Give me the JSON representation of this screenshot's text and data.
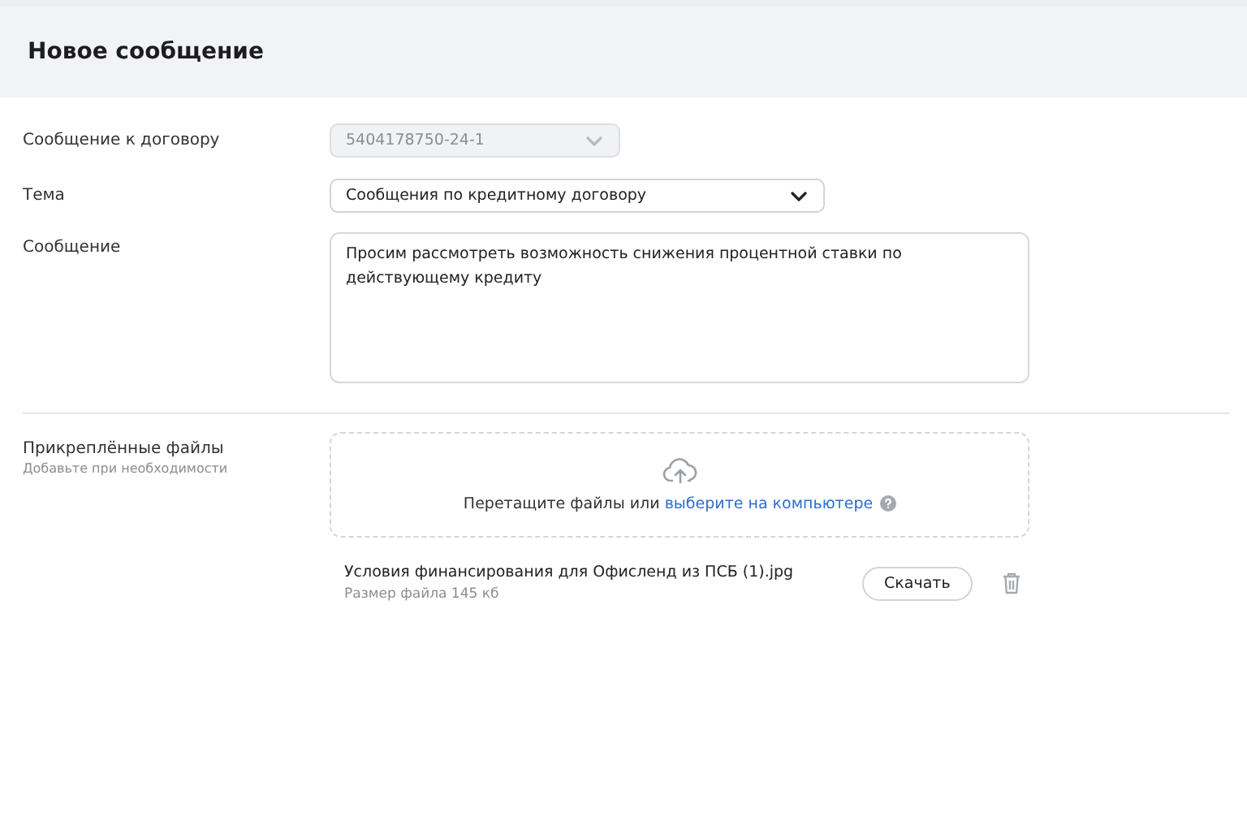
{
  "header": {
    "title": "Новое сообщение"
  },
  "form": {
    "contract": {
      "label": "Сообщение к договору",
      "value": "5404178750-24-1",
      "disabled": true
    },
    "topic": {
      "label": "Тема",
      "value": "Сообщения по кредитному договору",
      "disabled": false
    },
    "message": {
      "label": "Сообщение",
      "value": "Просим рассмотреть возможность снижения процентной ставки по действующему кредиту"
    }
  },
  "attachments": {
    "label": "Прикреплённые файлы",
    "hint": "Добавьте при необходимости",
    "dropzone": {
      "text": "Перетащите файлы или",
      "link": "выберите на компьютере"
    },
    "files": [
      {
        "name": "Условия финансирования для Офисленд из ПСБ (1).jpg",
        "size": "Размер файла 145 кб",
        "action": "Скачать"
      }
    ]
  }
}
